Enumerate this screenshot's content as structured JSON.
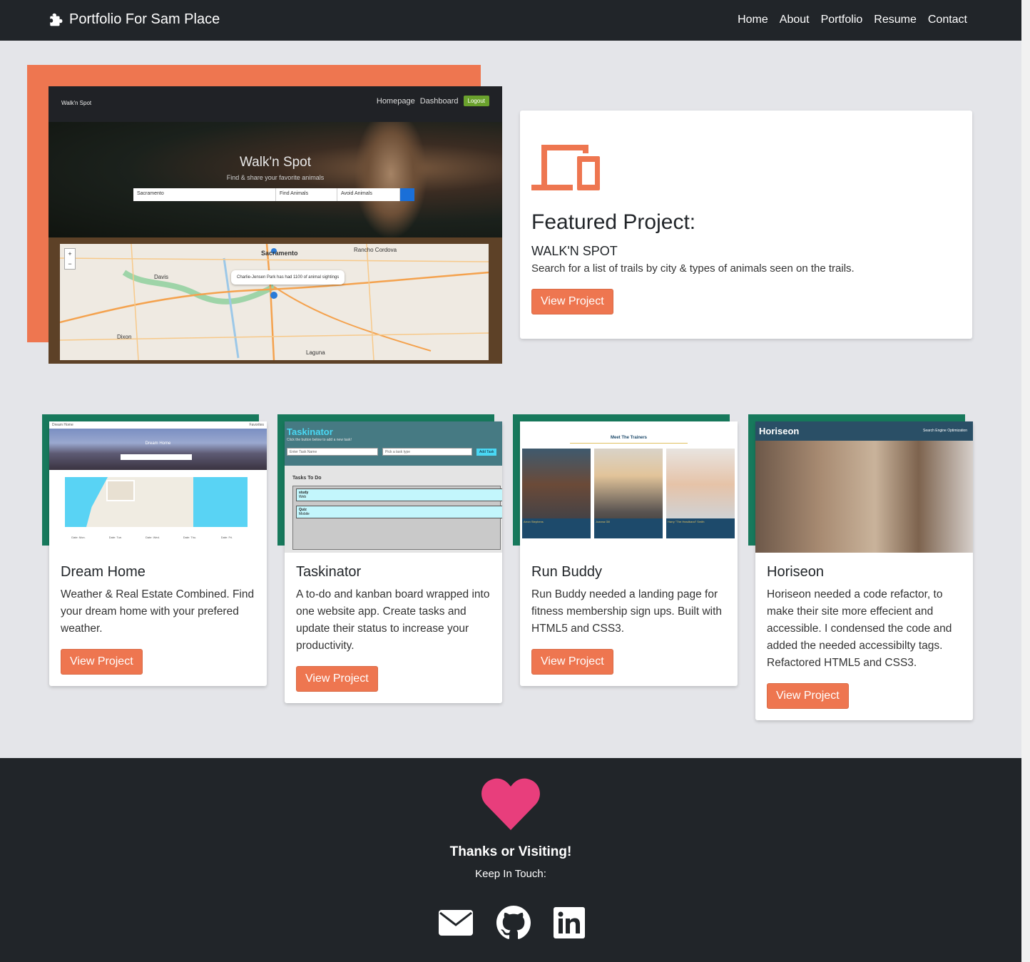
{
  "brand": {
    "title": "Portfolio For Sam Place",
    "icon": "puzzle-piece-icon"
  },
  "nav": {
    "items": [
      {
        "label": "Home"
      },
      {
        "label": "About"
      },
      {
        "label": "Portfolio"
      },
      {
        "label": "Resume"
      },
      {
        "label": "Contact"
      }
    ]
  },
  "featured_screenshot": {
    "logo": "Walk'n Spot",
    "nav_homepage": "Homepage",
    "nav_dashboard": "Dashboard",
    "nav_logout": "Logout",
    "hero_title": "Walk'n Spot",
    "hero_subtitle": "Find & share your favorite animals",
    "search_value": "Sacramento",
    "find_select": "Find Animals",
    "avoid_select": "Avoid Animals",
    "popup": "Charlie-Jensen Park has had 1100 of animal sightings",
    "cities": [
      "Sacramento",
      "Rancho Cordova",
      "Davis",
      "Dixon",
      "Laguna"
    ]
  },
  "featured": {
    "icon": "devices-icon",
    "heading": "Featured Project:",
    "name": "WALK'N SPOT",
    "description": "Search for a list of trails by city & types of animals seen on the trails.",
    "button": "View Project"
  },
  "projects": [
    {
      "title": "Dream Home",
      "description": "Weather & Real Estate Combined. Find your dream home with your prefered weather.",
      "button": "View Project",
      "shot": {
        "top": "Dream Home",
        "fav": "Favorites",
        "hero": "Dream Home",
        "days": [
          "Date: Mon.",
          "Date: Tue.",
          "Date: Wed.",
          "Date: Thu.",
          "Date: Fri."
        ]
      }
    },
    {
      "title": "Taskinator",
      "description": "A to-do and kanban board wrapped into one website app. Create tasks and update their status to increase your productivity.",
      "button": "View Project",
      "shot": {
        "title": "Taskinator",
        "sub": "Click the button below to add a new task!",
        "input": "Enter Task Name",
        "select": "Pick a task type",
        "add": "Add Task",
        "col": "Tasks To Do",
        "tasks": [
          "study",
          "Quiz"
        ],
        "types": [
          "Web",
          "Mobile"
        ]
      }
    },
    {
      "title": "Run Buddy",
      "description": "Run Buddy needed a landing page for fitness membership sign ups. Built with HTML5 and CSS3.",
      "button": "View Project",
      "shot": {
        "heading": "Meet The Trainers",
        "trainers": [
          "Arron Stephens",
          "Joanna Gill",
          "Harry \"The Headband\" Smith"
        ]
      }
    },
    {
      "title": "Horiseon",
      "description": "Horiseon needed a code refactor, to make their site more effecient and accessible. I condensed the code and added the needed accessibilty tags. Refactored HTML5 and CSS3.",
      "button": "View Project",
      "shot": {
        "title": "Horiseon",
        "nav": "Search Engine Optimization"
      }
    }
  ],
  "footer": {
    "icon": "heart-icon",
    "thanks": "Thanks or Visiting!",
    "keep": "Keep In Touch:",
    "socials": [
      "email-icon",
      "github-icon",
      "linkedin-icon"
    ]
  },
  "colors": {
    "accent": "#ee7650",
    "project_accent": "#17795c",
    "navbar": "#212529",
    "heart": "#e83e7c",
    "background": "#e4e5e9"
  }
}
